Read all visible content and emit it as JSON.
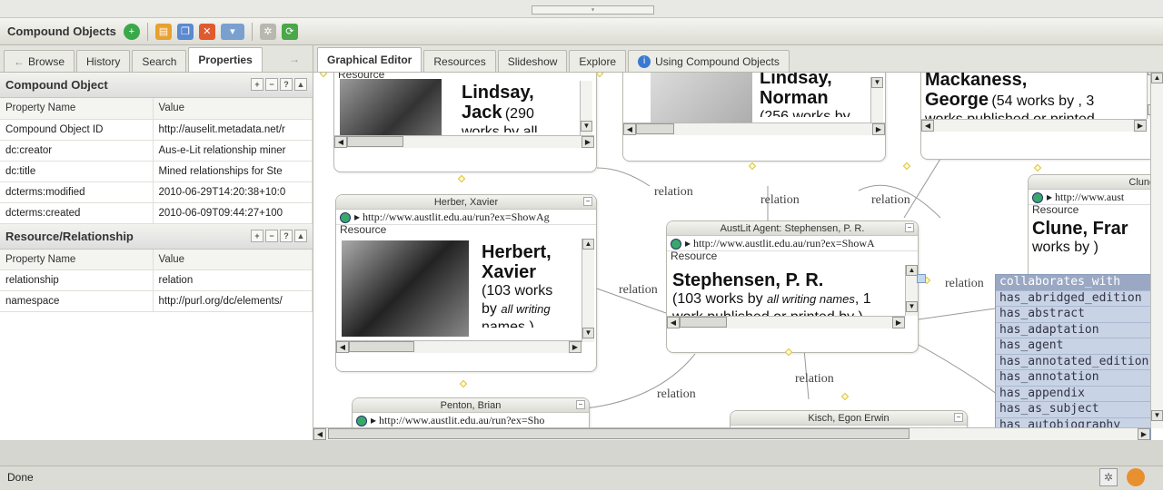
{
  "toolbar": {
    "title": "Compound Objects"
  },
  "left_tabs": [
    "Browse",
    "History",
    "Search",
    "Properties"
  ],
  "compound_object": {
    "section_title": "Compound Object",
    "header": [
      "Property Name",
      "Value"
    ],
    "rows": [
      [
        "Compound Object ID",
        "http://auselit.metadata.net/r"
      ],
      [
        "dc:creator",
        "Aus-e-Lit relationship miner"
      ],
      [
        "dc:title",
        "Mined relationships for Ste"
      ],
      [
        "dcterms:modified",
        "2010-06-29T14:20:38+10:0"
      ],
      [
        "dcterms:created",
        "2010-06-09T09:44:27+100"
      ]
    ]
  },
  "resource_relationship": {
    "section_title": "Resource/Relationship",
    "header": [
      "Property Name",
      "Value"
    ],
    "rows": [
      [
        "relationship",
        "relation"
      ],
      [
        "namespace",
        "http://purl.org/dc/elements/"
      ]
    ]
  },
  "main_tabs": [
    "Graphical Editor",
    "Resources",
    "Slideshow",
    "Explore",
    "Using Compound Objects"
  ],
  "nodes": {
    "lindsay_jack": {
      "name": "Lindsay,",
      "name2": "Jack",
      "count": "(290",
      "more": "works by all"
    },
    "lindsay_norman": {
      "name": "Lindsay,",
      "name2": "Norman",
      "more": "(256 works by"
    },
    "mackaness": {
      "name": "Mackaness,",
      "name2": "George",
      "count": "(54 works by , 3",
      "more": "works published or printed"
    },
    "herbert": {
      "title": "Herber, Xavier",
      "url": "http://www.austlit.edu.au/run?ex=ShowAg",
      "resource": "Resource",
      "name": "Herbert,",
      "name2": "Xavier",
      "count": "(103 works",
      "by": "by",
      "italic": "all writing",
      "more": "names )"
    },
    "stephensen": {
      "title": "AustLit Agent: Stephensen, P. R.",
      "url": "http://www.austlit.edu.au/run?ex=ShowA",
      "resource": "Resource",
      "name": "Stephensen, P. R.",
      "count": "(103 works by",
      "italic": "all writing names",
      "tail": ", 1",
      "more": "work published or printed by )"
    },
    "clune": {
      "title": "Clune, F",
      "url": "http://www.aust",
      "resource": "Resource",
      "name": "Clune, Frar",
      "count": "works by )"
    },
    "penton": {
      "title": "Penton, Brian",
      "url": "http://www.austlit.edu.au/run?ex=Sho"
    },
    "kisch": {
      "title": "Kisch, Egon Erwin"
    }
  },
  "relation_label": "relation",
  "dropdown_options": [
    "collaborates_with",
    "has_abridged_edition",
    "has_abstract",
    "has_adaptation",
    "has_agent",
    "has_annotated_edition",
    "has_annotation",
    "has_appendix",
    "has_as_subject",
    "has_autobiography"
  ],
  "status": "Done"
}
